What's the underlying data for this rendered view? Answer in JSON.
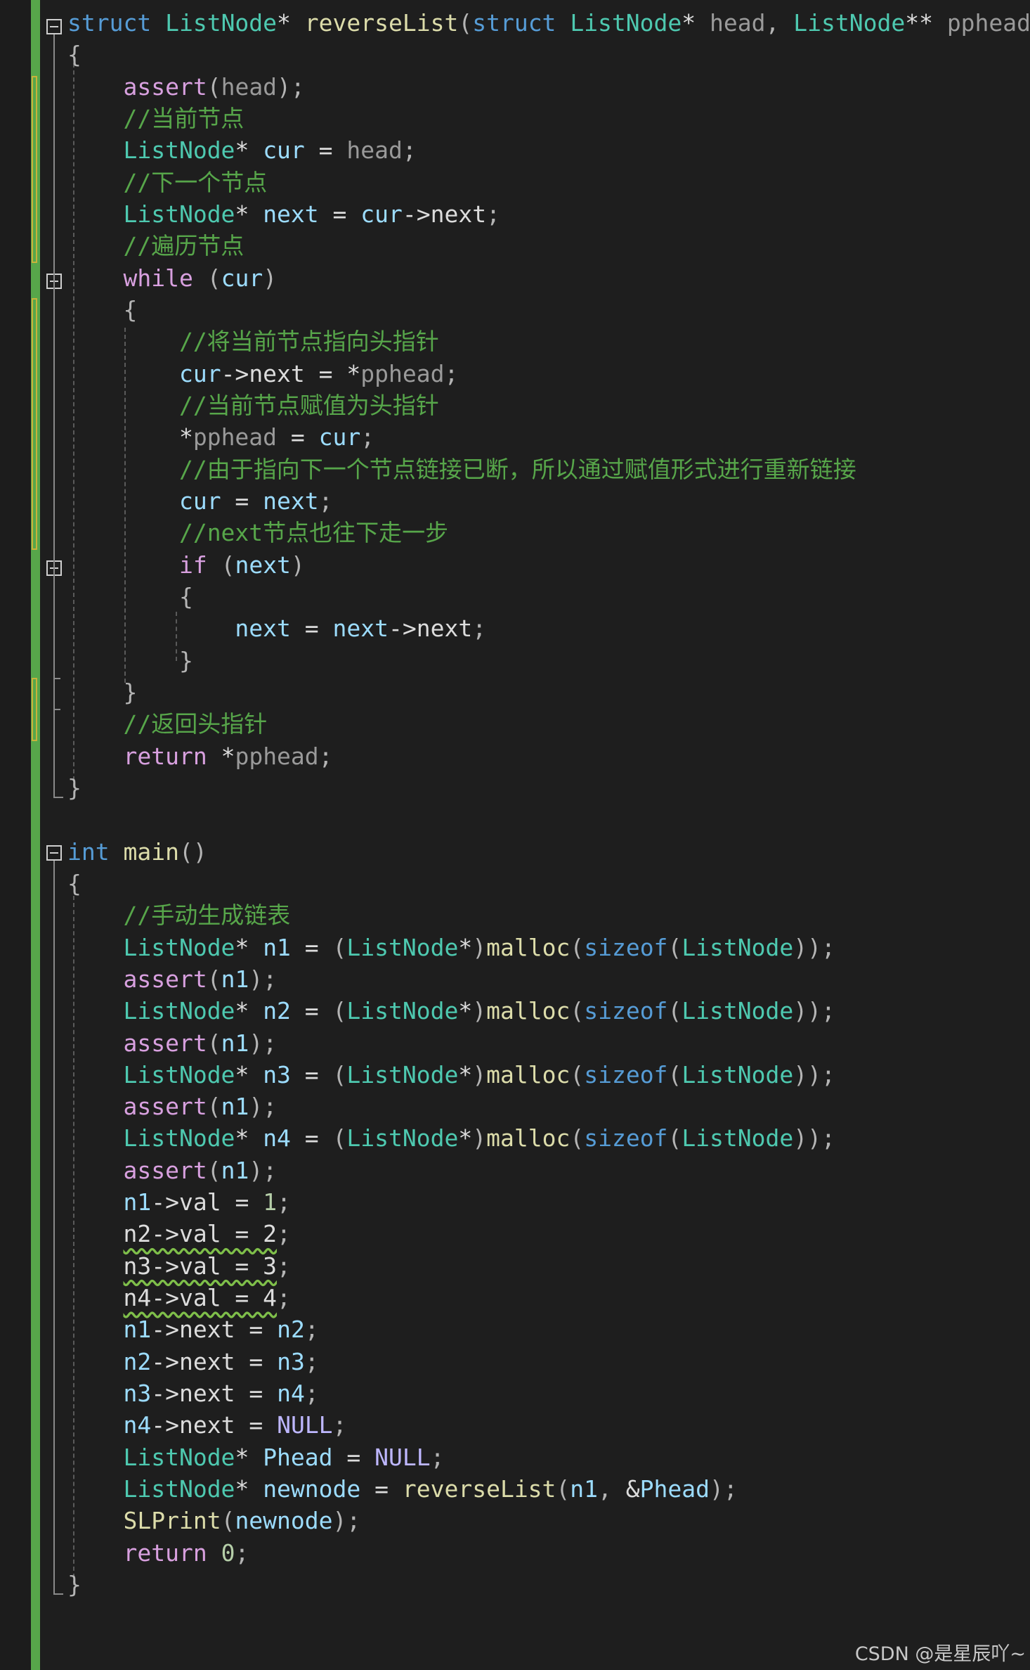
{
  "editor": {
    "code_lines": [
      [
        [
          "kw",
          "struct"
        ],
        [
          "pl",
          " "
        ],
        [
          "ty",
          "ListNode"
        ],
        [
          "pl",
          "* "
        ],
        [
          "fn",
          "reverseList"
        ],
        [
          "pn",
          "("
        ],
        [
          "kw",
          "struct"
        ],
        [
          "pl",
          " "
        ],
        [
          "ty",
          "ListNode"
        ],
        [
          "pl",
          "* "
        ],
        [
          "pm",
          "head"
        ],
        [
          "pn",
          ", "
        ],
        [
          "ty",
          "ListNode"
        ],
        [
          "pl",
          "** "
        ],
        [
          "pm",
          "pphead"
        ],
        [
          "pn",
          ")"
        ]
      ],
      [
        [
          "pn",
          "{"
        ]
      ],
      [
        [
          "pl",
          "    "
        ],
        [
          "ctl",
          "assert"
        ],
        [
          "pn",
          "("
        ],
        [
          "pm",
          "head"
        ],
        [
          "pn",
          ");"
        ]
      ],
      [
        [
          "pl",
          "    "
        ],
        [
          "cm",
          "//当前节点"
        ]
      ],
      [
        [
          "pl",
          "    "
        ],
        [
          "ty",
          "ListNode"
        ],
        [
          "pl",
          "* "
        ],
        [
          "vr",
          "cur"
        ],
        [
          "pl",
          " = "
        ],
        [
          "pm",
          "head"
        ],
        [
          "pn",
          ";"
        ]
      ],
      [
        [
          "pl",
          "    "
        ],
        [
          "cm",
          "//下一个节点"
        ]
      ],
      [
        [
          "pl",
          "    "
        ],
        [
          "ty",
          "ListNode"
        ],
        [
          "pl",
          "* "
        ],
        [
          "vr",
          "next"
        ],
        [
          "pl",
          " = "
        ],
        [
          "vr",
          "cur"
        ],
        [
          "pl",
          "->"
        ],
        [
          "pl",
          "next"
        ],
        [
          "pn",
          ";"
        ]
      ],
      [
        [
          "pl",
          "    "
        ],
        [
          "cm",
          "//遍历节点"
        ]
      ],
      [
        [
          "pl",
          "    "
        ],
        [
          "ctl",
          "while"
        ],
        [
          "pl",
          " "
        ],
        [
          "pn",
          "("
        ],
        [
          "vr",
          "cur"
        ],
        [
          "pn",
          ")"
        ]
      ],
      [
        [
          "pl",
          "    "
        ],
        [
          "pn",
          "{"
        ]
      ],
      [
        [
          "pl",
          "        "
        ],
        [
          "cm",
          "//将当前节点指向头指针"
        ]
      ],
      [
        [
          "pl",
          "        "
        ],
        [
          "vr",
          "cur"
        ],
        [
          "pl",
          "->"
        ],
        [
          "pl",
          "next"
        ],
        [
          "pl",
          " = *"
        ],
        [
          "pm",
          "pphead"
        ],
        [
          "pn",
          ";"
        ]
      ],
      [
        [
          "pl",
          "        "
        ],
        [
          "cm",
          "//当前节点赋值为头指针"
        ]
      ],
      [
        [
          "pl",
          "        "
        ],
        [
          "pl",
          "*"
        ],
        [
          "pm",
          "pphead"
        ],
        [
          "pl",
          " = "
        ],
        [
          "vr",
          "cur"
        ],
        [
          "pn",
          ";"
        ]
      ],
      [
        [
          "pl",
          "        "
        ],
        [
          "cm",
          "//由于指向下一个节点链接已断，所以通过赋值形式进行重新链接"
        ]
      ],
      [
        [
          "pl",
          "        "
        ],
        [
          "vr",
          "cur"
        ],
        [
          "pl",
          " = "
        ],
        [
          "vr",
          "next"
        ],
        [
          "pn",
          ";"
        ]
      ],
      [
        [
          "pl",
          "        "
        ],
        [
          "cm",
          "//next节点也往下走一步"
        ]
      ],
      [
        [
          "pl",
          "        "
        ],
        [
          "ctl",
          "if"
        ],
        [
          "pl",
          " "
        ],
        [
          "pn",
          "("
        ],
        [
          "vr",
          "next"
        ],
        [
          "pn",
          ")"
        ]
      ],
      [
        [
          "pl",
          "        "
        ],
        [
          "pn",
          "{"
        ]
      ],
      [
        [
          "pl",
          "            "
        ],
        [
          "vr",
          "next"
        ],
        [
          "pl",
          " = "
        ],
        [
          "vr",
          "next"
        ],
        [
          "pl",
          "->"
        ],
        [
          "pl",
          "next"
        ],
        [
          "pn",
          ";"
        ]
      ],
      [
        [
          "pl",
          "        "
        ],
        [
          "pn",
          "}"
        ]
      ],
      [
        [
          "pl",
          "    "
        ],
        [
          "pn",
          "}"
        ]
      ],
      [
        [
          "pl",
          "    "
        ],
        [
          "cm",
          "//返回头指针"
        ]
      ],
      [
        [
          "pl",
          "    "
        ],
        [
          "ctl",
          "return"
        ],
        [
          "pl",
          " *"
        ],
        [
          "pm",
          "pphead"
        ],
        [
          "pn",
          ";"
        ]
      ],
      [
        [
          "pn",
          "}"
        ]
      ],
      [],
      [
        [
          "kw",
          "int"
        ],
        [
          "pl",
          " "
        ],
        [
          "fn",
          "main"
        ],
        [
          "pn",
          "()"
        ]
      ],
      [
        [
          "pn",
          "{"
        ]
      ],
      [
        [
          "pl",
          "    "
        ],
        [
          "cm",
          "//手动生成链表"
        ]
      ],
      [
        [
          "pl",
          "    "
        ],
        [
          "ty",
          "ListNode"
        ],
        [
          "pl",
          "* "
        ],
        [
          "vr",
          "n1"
        ],
        [
          "pl",
          " = "
        ],
        [
          "pn",
          "("
        ],
        [
          "ty",
          "ListNode"
        ],
        [
          "pl",
          "*"
        ],
        [
          "pn",
          ")"
        ],
        [
          "fn",
          "malloc"
        ],
        [
          "pn",
          "("
        ],
        [
          "kw",
          "sizeof"
        ],
        [
          "pn",
          "("
        ],
        [
          "ty",
          "ListNode"
        ],
        [
          "pn",
          "));"
        ]
      ],
      [
        [
          "pl",
          "    "
        ],
        [
          "ctl",
          "assert"
        ],
        [
          "pn",
          "("
        ],
        [
          "vr",
          "n1"
        ],
        [
          "pn",
          ");"
        ]
      ],
      [
        [
          "pl",
          "    "
        ],
        [
          "ty",
          "ListNode"
        ],
        [
          "pl",
          "* "
        ],
        [
          "vr",
          "n2"
        ],
        [
          "pl",
          " = "
        ],
        [
          "pn",
          "("
        ],
        [
          "ty",
          "ListNode"
        ],
        [
          "pl",
          "*"
        ],
        [
          "pn",
          ")"
        ],
        [
          "fn",
          "malloc"
        ],
        [
          "pn",
          "("
        ],
        [
          "kw",
          "sizeof"
        ],
        [
          "pn",
          "("
        ],
        [
          "ty",
          "ListNode"
        ],
        [
          "pn",
          "));"
        ]
      ],
      [
        [
          "pl",
          "    "
        ],
        [
          "ctl",
          "assert"
        ],
        [
          "pn",
          "("
        ],
        [
          "vr",
          "n1"
        ],
        [
          "pn",
          ");"
        ]
      ],
      [
        [
          "pl",
          "    "
        ],
        [
          "ty",
          "ListNode"
        ],
        [
          "pl",
          "* "
        ],
        [
          "vr",
          "n3"
        ],
        [
          "pl",
          " = "
        ],
        [
          "pn",
          "("
        ],
        [
          "ty",
          "ListNode"
        ],
        [
          "pl",
          "*"
        ],
        [
          "pn",
          ")"
        ],
        [
          "fn",
          "malloc"
        ],
        [
          "pn",
          "("
        ],
        [
          "kw",
          "sizeof"
        ],
        [
          "pn",
          "("
        ],
        [
          "ty",
          "ListNode"
        ],
        [
          "pn",
          "));"
        ]
      ],
      [
        [
          "pl",
          "    "
        ],
        [
          "ctl",
          "assert"
        ],
        [
          "pn",
          "("
        ],
        [
          "vr",
          "n1"
        ],
        [
          "pn",
          ");"
        ]
      ],
      [
        [
          "pl",
          "    "
        ],
        [
          "ty",
          "ListNode"
        ],
        [
          "pl",
          "* "
        ],
        [
          "vr",
          "n4"
        ],
        [
          "pl",
          " = "
        ],
        [
          "pn",
          "("
        ],
        [
          "ty",
          "ListNode"
        ],
        [
          "pl",
          "*"
        ],
        [
          "pn",
          ")"
        ],
        [
          "fn",
          "malloc"
        ],
        [
          "pn",
          "("
        ],
        [
          "kw",
          "sizeof"
        ],
        [
          "pn",
          "("
        ],
        [
          "ty",
          "ListNode"
        ],
        [
          "pn",
          "));"
        ]
      ],
      [
        [
          "pl",
          "    "
        ],
        [
          "ctl",
          "assert"
        ],
        [
          "pn",
          "("
        ],
        [
          "vr",
          "n1"
        ],
        [
          "pn",
          ");"
        ]
      ],
      [
        [
          "pl",
          "    "
        ],
        [
          "vr",
          "n1"
        ],
        [
          "pl",
          "->"
        ],
        [
          "pl",
          "val"
        ],
        [
          "pl",
          " = "
        ],
        [
          "nm",
          "1"
        ],
        [
          "pn",
          ";"
        ]
      ],
      [
        [
          "pl",
          "    "
        ],
        [
          "sq",
          "n2->val = 2"
        ],
        [
          "pn",
          ";"
        ]
      ],
      [
        [
          "pl",
          "    "
        ],
        [
          "sq",
          "n3->val = 3"
        ],
        [
          "pn",
          ";"
        ]
      ],
      [
        [
          "pl",
          "    "
        ],
        [
          "sq",
          "n4->val = 4"
        ],
        [
          "pn",
          ";"
        ]
      ],
      [
        [
          "pl",
          "    "
        ],
        [
          "vr",
          "n1"
        ],
        [
          "pl",
          "->"
        ],
        [
          "pl",
          "next"
        ],
        [
          "pl",
          " = "
        ],
        [
          "vr",
          "n2"
        ],
        [
          "pn",
          ";"
        ]
      ],
      [
        [
          "pl",
          "    "
        ],
        [
          "vr",
          "n2"
        ],
        [
          "pl",
          "->"
        ],
        [
          "pl",
          "next"
        ],
        [
          "pl",
          " = "
        ],
        [
          "vr",
          "n3"
        ],
        [
          "pn",
          ";"
        ]
      ],
      [
        [
          "pl",
          "    "
        ],
        [
          "vr",
          "n3"
        ],
        [
          "pl",
          "->"
        ],
        [
          "pl",
          "next"
        ],
        [
          "pl",
          " = "
        ],
        [
          "vr",
          "n4"
        ],
        [
          "pn",
          ";"
        ]
      ],
      [
        [
          "pl",
          "    "
        ],
        [
          "vr",
          "n4"
        ],
        [
          "pl",
          "->"
        ],
        [
          "pl",
          "next"
        ],
        [
          "pl",
          " = "
        ],
        [
          "mac",
          "NULL"
        ],
        [
          "pn",
          ";"
        ]
      ],
      [
        [
          "pl",
          "    "
        ],
        [
          "ty",
          "ListNode"
        ],
        [
          "pl",
          "* "
        ],
        [
          "vr",
          "Phead"
        ],
        [
          "pl",
          " = "
        ],
        [
          "mac",
          "NULL"
        ],
        [
          "pn",
          ";"
        ]
      ],
      [
        [
          "pl",
          "    "
        ],
        [
          "ty",
          "ListNode"
        ],
        [
          "pl",
          "* "
        ],
        [
          "vr",
          "newnode"
        ],
        [
          "pl",
          " = "
        ],
        [
          "fn",
          "reverseList"
        ],
        [
          "pn",
          "("
        ],
        [
          "vr",
          "n1"
        ],
        [
          "pn",
          ", "
        ],
        [
          "pl",
          "&"
        ],
        [
          "vr",
          "Phead"
        ],
        [
          "pn",
          ");"
        ]
      ],
      [
        [
          "pl",
          "    "
        ],
        [
          "fn",
          "SLPrint"
        ],
        [
          "pn",
          "("
        ],
        [
          "vr",
          "newnode"
        ],
        [
          "pn",
          ");"
        ]
      ],
      [
        [
          "pl",
          "    "
        ],
        [
          "ctl",
          "return"
        ],
        [
          "pl",
          " "
        ],
        [
          "nm",
          "0"
        ],
        [
          "pn",
          ";"
        ]
      ],
      [
        [
          "pn",
          "}"
        ]
      ]
    ]
  },
  "watermark": "CSDN @是星辰吖~"
}
